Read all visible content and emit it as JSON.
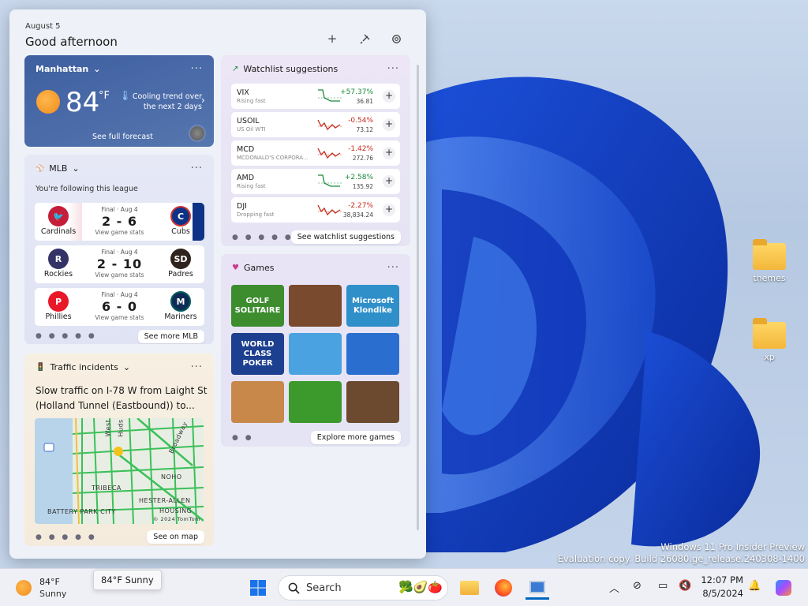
{
  "board": {
    "date": "August 5",
    "greeting": "Good afternoon",
    "header_icons": [
      "plus-icon",
      "pin-icon",
      "gear-icon"
    ]
  },
  "weather": {
    "location": "Manhattan",
    "temp": "84",
    "unit": "°F",
    "trend": "Cooling trend over the next 2 days",
    "forecast_link": "See full forecast"
  },
  "mlb": {
    "title": "MLB",
    "subtitle": "You're following this league",
    "games": [
      {
        "away": "Cardinals",
        "home": "Cubs",
        "status": "Final · Aug 4",
        "score": "2 - 6",
        "link": "View game stats"
      },
      {
        "away": "Rockies",
        "home": "Padres",
        "status": "Final · Aug 4",
        "score": "2 - 10",
        "link": "View game stats"
      },
      {
        "away": "Phillies",
        "home": "Mariners",
        "status": "Final · Aug 4",
        "score": "6 - 0",
        "link": "View game stats"
      }
    ],
    "more": "See more MLB"
  },
  "traffic": {
    "title": "Traffic incidents",
    "headline": "Slow traffic on I-78 W from Laight St (Holland Tunnel (Eastbound)) to...",
    "map_labels": [
      "NOHO",
      "TRIBECA",
      "HESTER-ALLEN",
      "HOUSING",
      "BATTERY PARK CITY",
      "Broadway",
      "West",
      "Huds",
      "© 2024 TomTom"
    ],
    "more": "See on map"
  },
  "watchlist": {
    "title": "Watchlist suggestions",
    "stocks": [
      {
        "sym": "VIX",
        "name": "Rising fast",
        "pct": "+57.37%",
        "price": "36.81",
        "dir": "up"
      },
      {
        "sym": "USOIL",
        "name": "US Oil WTI",
        "pct": "-0.54%",
        "price": "73.12",
        "dir": "down"
      },
      {
        "sym": "MCD",
        "name": "MCDONALD'S CORPORA...",
        "pct": "-1.42%",
        "price": "272.76",
        "dir": "down"
      },
      {
        "sym": "AMD",
        "name": "Rising fast",
        "pct": "+2.58%",
        "price": "135.92",
        "dir": "up"
      },
      {
        "sym": "DJI",
        "name": "Dropping fast",
        "pct": "-2.27%",
        "price": "38,834.24",
        "dir": "down"
      }
    ],
    "more": "See watchlist suggestions"
  },
  "games": {
    "title": "Games",
    "tiles": [
      {
        "label": "GOLF SOLITAIRE",
        "color": "#3d8d2f"
      },
      {
        "label": "",
        "color": "#7a4a2e"
      },
      {
        "label": "Microsoft Klondike",
        "color": "#2f8fc9"
      },
      {
        "label": "WORLD CLASS POKER",
        "color": "#1d3f8f"
      },
      {
        "label": "",
        "color": "#4aa3e0"
      },
      {
        "label": "",
        "color": "#2a6fd0"
      },
      {
        "label": "",
        "color": "#c7884a"
      },
      {
        "label": "",
        "color": "#3c9a2c"
      },
      {
        "label": "",
        "color": "#6b4a30"
      }
    ],
    "more": "Explore more games"
  },
  "desktop": {
    "icons": [
      {
        "label": "themes"
      },
      {
        "label": "xp"
      }
    ],
    "watermark1": "Windows 11 Pro Insider Preview",
    "watermark2": "Evaluation copy. Build 26080.ge_release.240308-1400"
  },
  "taskbar": {
    "weather_temp": "84°F",
    "weather_desc": "Sunny",
    "tooltip": "84°F Sunny",
    "search": "Search",
    "time": "12:07 PM",
    "date": "8/5/2024"
  },
  "colors": {
    "up": "#1a8a3a",
    "down": "#c42b1c",
    "accent": "#0067c0"
  }
}
